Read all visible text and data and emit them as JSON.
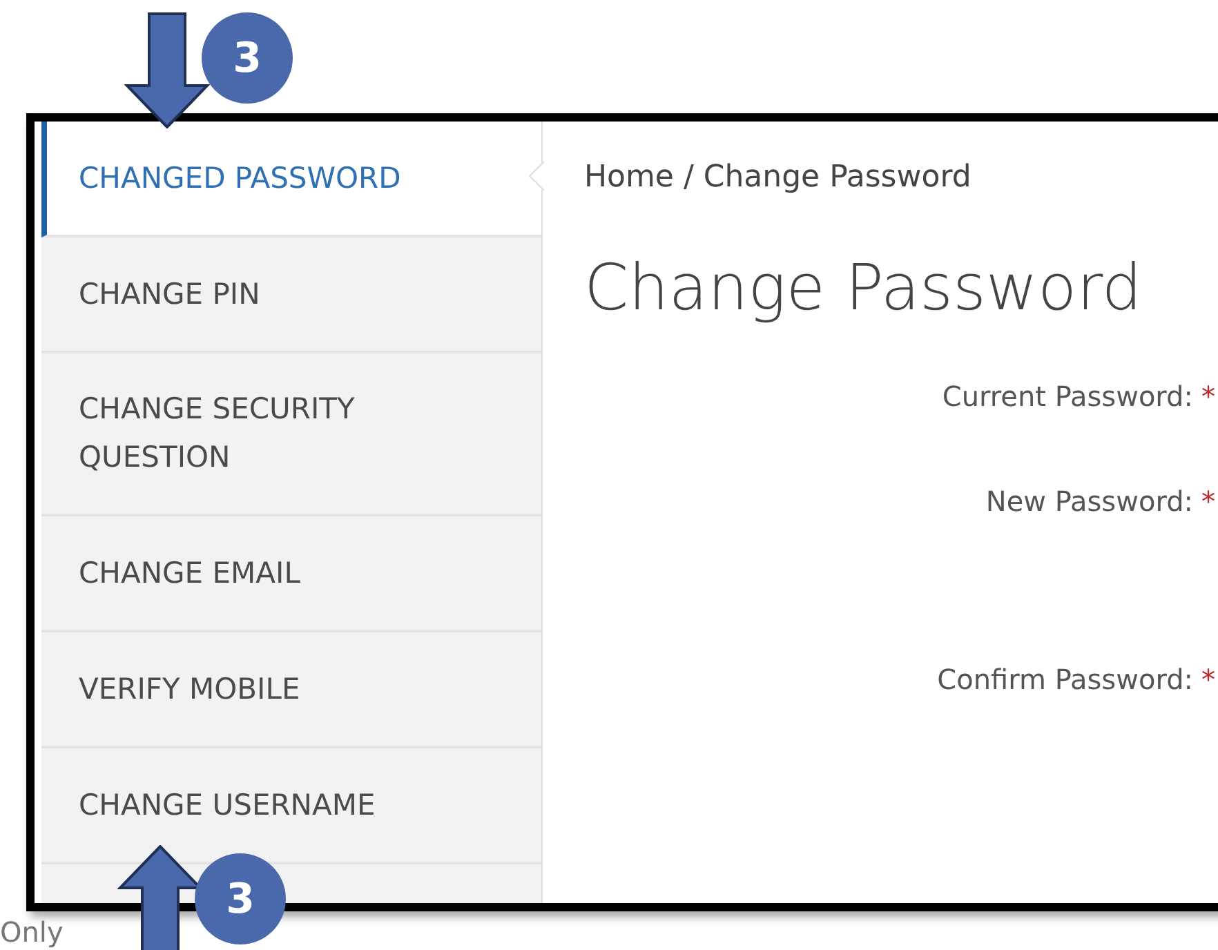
{
  "callouts": [
    {
      "kind": "down",
      "badge": "3"
    },
    {
      "kind": "up",
      "badge": "3"
    }
  ],
  "side_note": "Only",
  "sidebar": {
    "items": [
      {
        "label": "CHANGED PASSWORD",
        "selected": true
      },
      {
        "label": "CHANGE PIN",
        "selected": false
      },
      {
        "label": "CHANGE SECURITY QUESTION",
        "selected": false
      },
      {
        "label": "CHANGE EMAIL",
        "selected": false
      },
      {
        "label": "VERIFY MOBILE",
        "selected": false
      },
      {
        "label": "CHANGE USERNAME",
        "selected": false
      }
    ]
  },
  "breadcrumb": "Home / Change Password",
  "heading": "Change Password",
  "fields": [
    {
      "label": "Current Password:",
      "required": true,
      "mark": "*",
      "kind": "single"
    },
    {
      "label": "New Password:",
      "required": true,
      "mark": "*",
      "kind": "tall"
    },
    {
      "label": "Confirm Password:",
      "required": true,
      "mark": "*",
      "kind": "single"
    }
  ]
}
